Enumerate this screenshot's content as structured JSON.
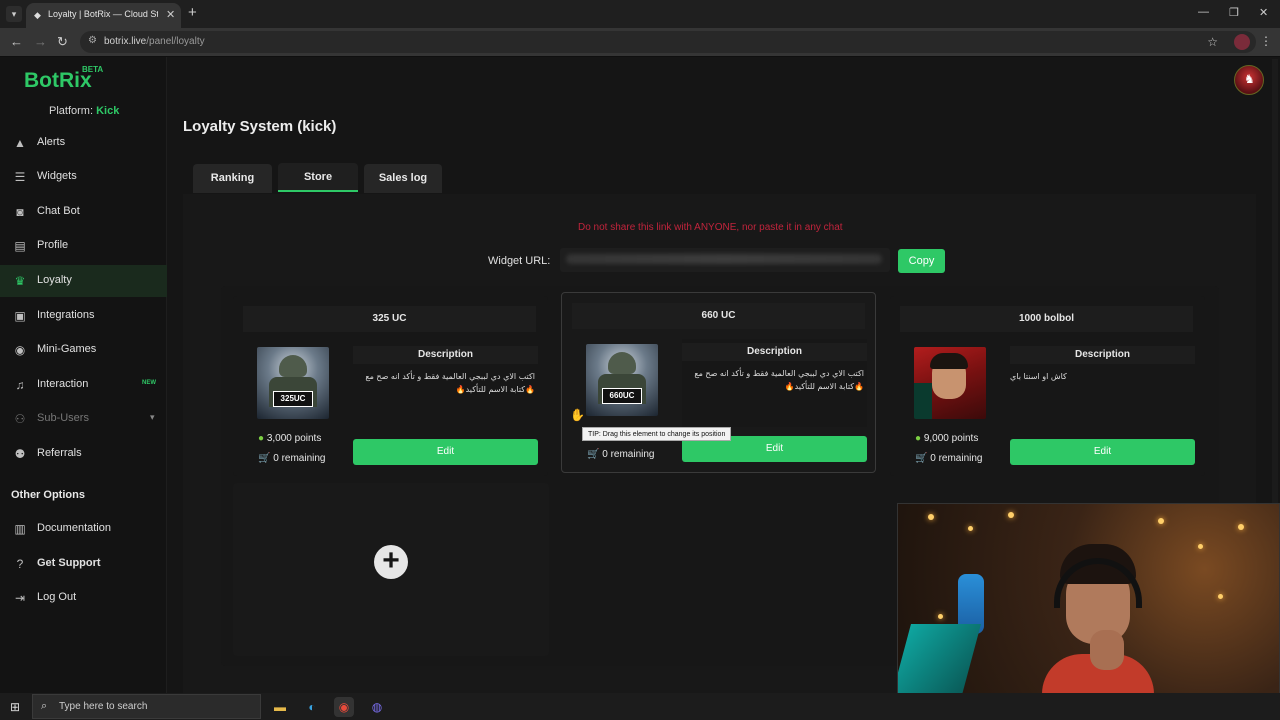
{
  "browser": {
    "tab_title": "Loyalty | BotRix — Cloud Stream",
    "url_host": "botrix.live",
    "url_path": "/panel/loyalty"
  },
  "app": {
    "logo": "BotRix",
    "logo_badge": "BETA",
    "platform_label": "Platform:",
    "platform_value": "Kick"
  },
  "sidebar": {
    "items": [
      {
        "label": "Alerts",
        "icon": "alert-icon"
      },
      {
        "label": "Widgets",
        "icon": "widgets-icon"
      },
      {
        "label": "Chat Bot",
        "icon": "robot-icon"
      },
      {
        "label": "Profile",
        "icon": "profile-card-icon"
      },
      {
        "label": "Loyalty",
        "icon": "trophy-icon"
      },
      {
        "label": "Integrations",
        "icon": "integrations-icon"
      },
      {
        "label": "Mini-Games",
        "icon": "gamepad-icon"
      },
      {
        "label": "Interaction",
        "icon": "music-note-icon",
        "badge": "NEW"
      },
      {
        "label": "Sub-Users",
        "icon": "users-icon"
      },
      {
        "label": "Referrals",
        "icon": "referrals-icon"
      }
    ],
    "other_heading": "Other Options",
    "other_items": [
      {
        "label": "Documentation",
        "icon": "document-icon"
      },
      {
        "label": "Get Support",
        "icon": "help-icon"
      },
      {
        "label": "Log Out",
        "icon": "logout-icon"
      }
    ]
  },
  "main": {
    "title": "Loyalty System (kick)",
    "tabs": [
      "Ranking",
      "Store",
      "Sales log"
    ],
    "warning": "Do not share this link with ANYONE, nor paste it in any chat",
    "widget_url_label": "Widget URL:",
    "copy_label": "Copy",
    "cards": [
      {
        "title": "325 UC",
        "thumb_label": "325UC",
        "description_heading": "Description",
        "description": "اكتب الاي دي لببجي العالمية فقط و تأكد انه صح مع 🔥كتابة الاسم للتأكيد🔥",
        "points": "3,000 points",
        "remaining": "0 remaining",
        "edit_label": "Edit"
      },
      {
        "title": "660 UC",
        "thumb_label": "660UC",
        "description_heading": "Description",
        "description": "اكتب الاي دي لببجي العالمية فقط و تأكد انه صح مع 🔥كتابة الاسم للتأكيد🔥",
        "points": "",
        "remaining": "0 remaining",
        "edit_label": "Edit",
        "tooltip": "TIP: Drag this element to change its position"
      },
      {
        "title": "1000 bolbol",
        "thumb_label": "",
        "description_heading": "Description",
        "description": "كاش او اسنتا باي",
        "points": "9,000 points",
        "remaining": "0 remaining",
        "edit_label": "Edit"
      }
    ]
  },
  "taskbar": {
    "search_placeholder": "Type here to search"
  },
  "colors": {
    "accent": "#2ec866",
    "warning": "#c0243c"
  }
}
